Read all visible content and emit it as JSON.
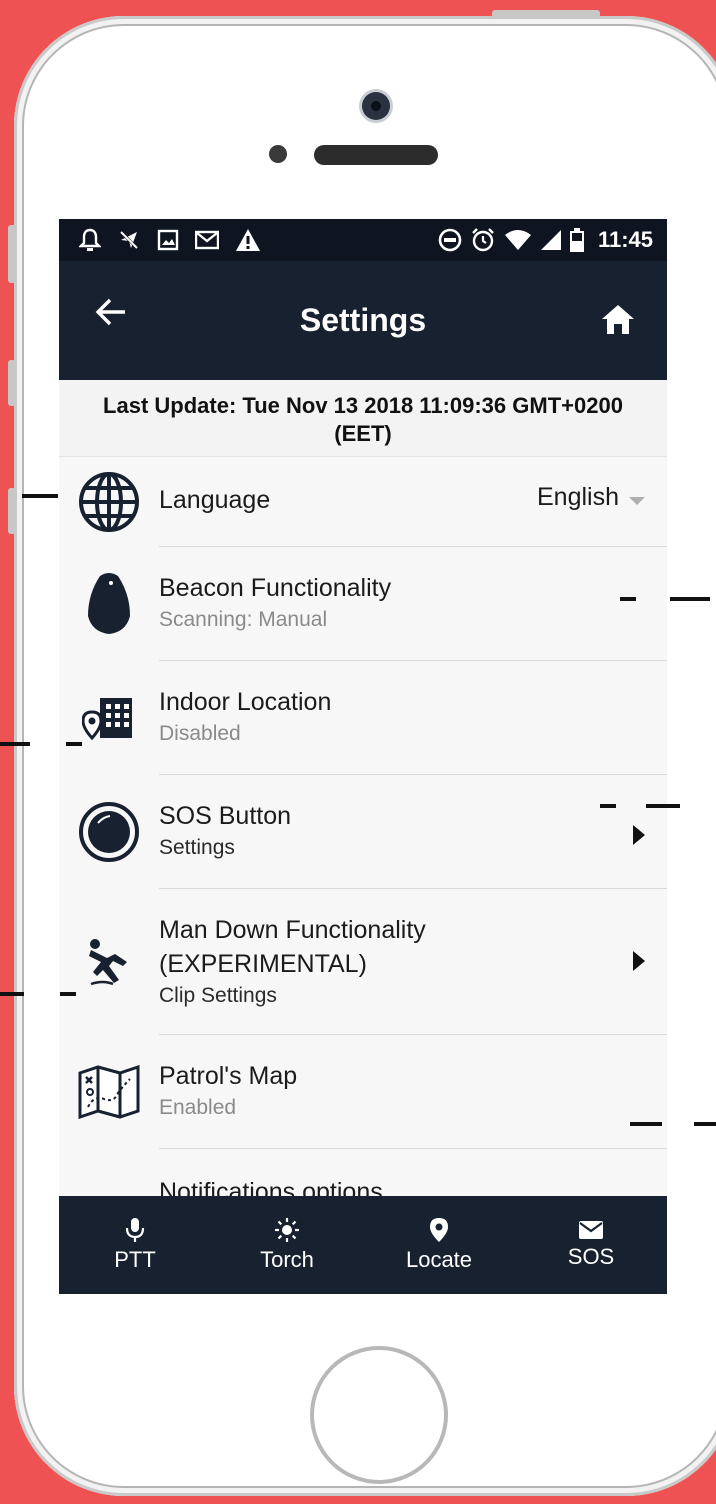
{
  "status_bar": {
    "left_icons": [
      "bell-icon",
      "no-location-icon",
      "image-icon",
      "gmail-icon",
      "warning-icon"
    ],
    "right_icons": [
      "dnd-icon",
      "alarm-icon",
      "wifi-icon",
      "signal-icon",
      "battery-icon"
    ],
    "time": "11:45"
  },
  "app_bar": {
    "title": "Settings",
    "back_icon": "back-arrow-icon",
    "home_icon": "home-icon"
  },
  "last_update": "Last Update: Tue Nov 13 2018 11:09:36 GMT+0200 (EET)",
  "settings": {
    "language": {
      "label": "Language",
      "value": "English",
      "icon": "globe-icon"
    },
    "beacon": {
      "label": "Beacon Functionality",
      "sub": "Scanning: Manual",
      "icon": "beacon-icon"
    },
    "indoor": {
      "label": "Indoor Location",
      "sub": "Disabled",
      "icon": "building-pin-icon"
    },
    "sos_button": {
      "label": "SOS Button",
      "sub": "Settings",
      "icon": "sos-button-icon"
    },
    "man_down": {
      "label_line1": "Man Down Functionality",
      "label_line2": "(EXPERIMENTAL)",
      "sub": "Clip Settings",
      "icon": "falling-person-icon"
    },
    "patrol_map": {
      "label": "Patrol's Map",
      "sub": "Enabled",
      "icon": "map-icon"
    },
    "notifications": {
      "label": "Notifications options",
      "icon": "more-dots-icon"
    }
  },
  "bottom_nav": [
    {
      "label": "PTT",
      "icon": "microphone-icon"
    },
    {
      "label": "Torch",
      "icon": "sun-icon"
    },
    {
      "label": "Locate",
      "icon": "location-pin-icon"
    },
    {
      "label": "SOS",
      "icon": "envelope-icon"
    }
  ],
  "colors": {
    "background": "#ee5253",
    "app_bar": "#17212f",
    "status_bar": "#0e1520"
  }
}
